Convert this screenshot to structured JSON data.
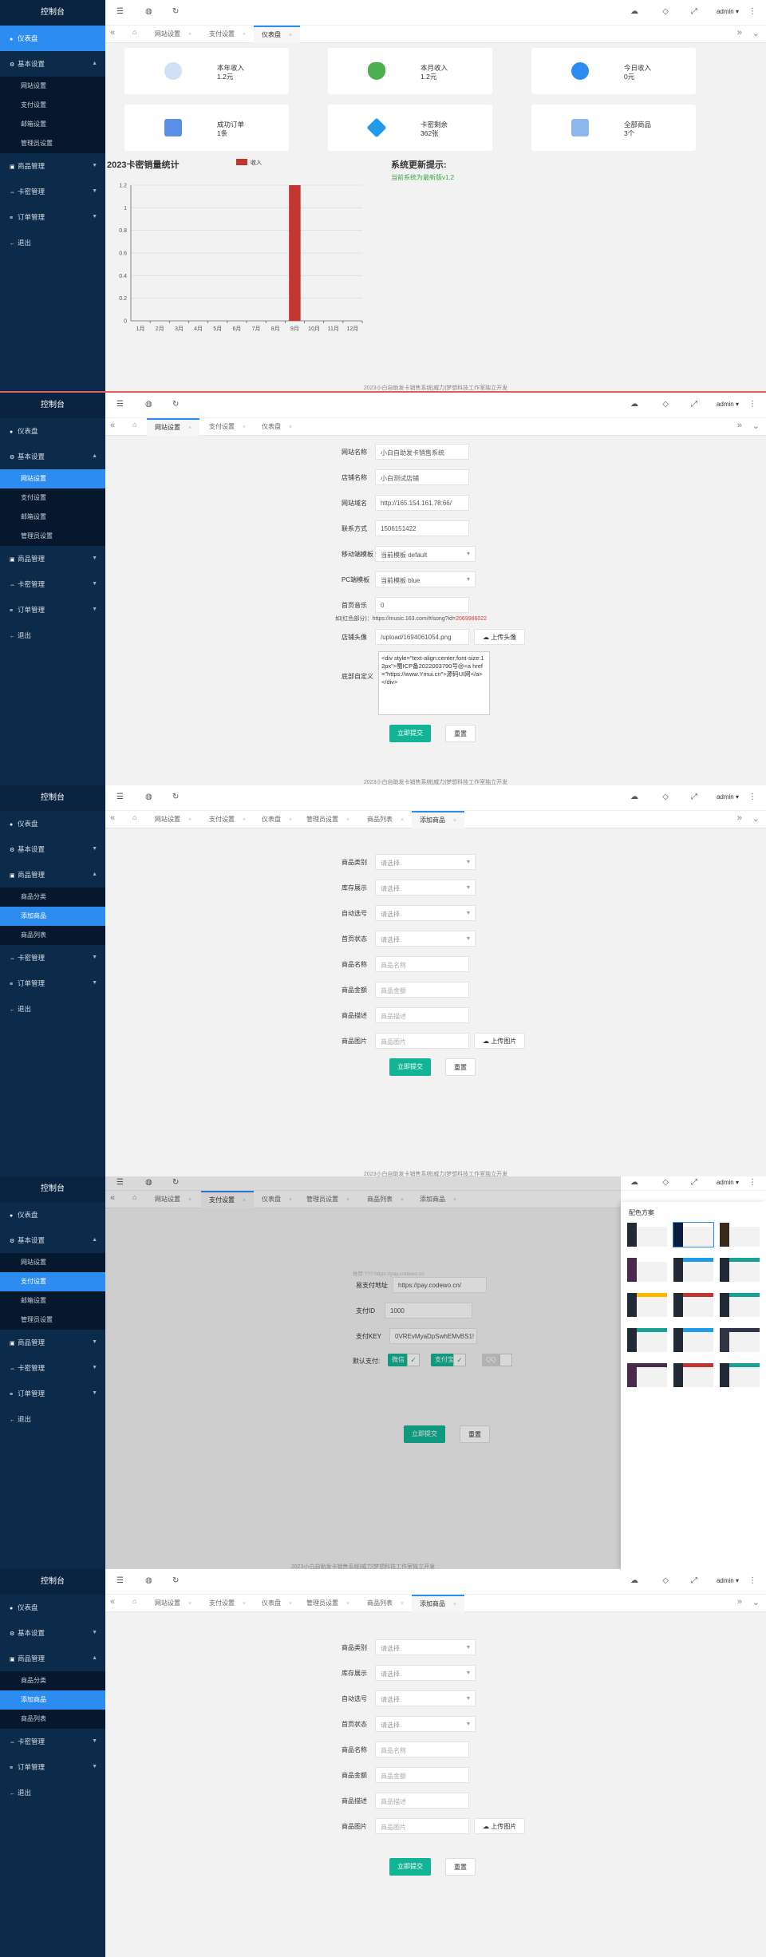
{
  "common": {
    "logo": "控制台",
    "admin": "admin ▾",
    "footer": "2023小白自助发卡销售系统|威力|梦想科技工作室独立开发"
  },
  "menu": {
    "dashboard": "仪表盘",
    "basic": "基本设置",
    "goods": "商品管理",
    "cards": "卡密管理",
    "orders": "订单管理",
    "logout": "退出",
    "basic_sub": [
      "网站设置",
      "支付设置",
      "邮箱设置",
      "管理员设置"
    ],
    "goods_sub": [
      "商品分类",
      "添加商品",
      "商品列表"
    ]
  },
  "tabs": {
    "site": "网站设置",
    "pay": "支付设置",
    "dash": "仪表盘",
    "admin": "管理员设置",
    "list": "商品列表",
    "add": "添加商品"
  },
  "dashboard": {
    "cards": [
      {
        "label": "本年收入",
        "value": "1.2元",
        "icon": "pie-icon",
        "color": "#8cb8ef"
      },
      {
        "label": "本月收入",
        "value": "1.2元",
        "icon": "money-bag-icon",
        "color": "#4caf50"
      },
      {
        "label": "今日收入",
        "value": "0元",
        "icon": "dollar-icon",
        "color": "#2d8cf0"
      },
      {
        "label": "成功订单",
        "value": "1条",
        "icon": "star-badge-icon",
        "color": "#5b8ee6"
      },
      {
        "label": "卡密剩余",
        "value": "362张",
        "icon": "cube-icon",
        "color": "#1e9be8"
      },
      {
        "label": "全部商品",
        "value": "3个",
        "icon": "chart-line-icon",
        "color": "#8cb8ef"
      }
    ],
    "notice_title": "系统更新提示:",
    "notice_text": "当前系统为最新版v1.2"
  },
  "chart_data": {
    "type": "bar",
    "title": "2023卡密销量统计",
    "legend": [
      "收入"
    ],
    "categories": [
      "1月",
      "2月",
      "3月",
      "4月",
      "5月",
      "6月",
      "7月",
      "8月",
      "9月",
      "10月",
      "11月",
      "12月"
    ],
    "series": [
      {
        "name": "收入",
        "values": [
          0,
          0,
          0,
          0,
          0,
          0,
          0,
          0,
          1.2,
          0,
          0,
          0
        ]
      }
    ],
    "yticks": [
      "0",
      "0.2",
      "0.4",
      "0.6",
      "0.8",
      "1",
      "1.2"
    ],
    "ylim": [
      0,
      1.2
    ],
    "color": "#c23531",
    "grid": true,
    "legend_position": "top"
  },
  "site": {
    "fields": [
      {
        "label": "网站名称",
        "value": "小白自助发卡销售系统"
      },
      {
        "label": "店铺名称",
        "value": "小白测试店铺"
      },
      {
        "label": "网站域名",
        "value": "http://165.154.161.78:66/"
      },
      {
        "label": "联系方式",
        "value": "1506151422"
      },
      {
        "label": "移动端模板",
        "value": "当前模板 default"
      },
      {
        "label": "PC端模板",
        "value": "当前模板 blue"
      },
      {
        "label": "首页音乐",
        "value": "0"
      }
    ],
    "music_hint": "如(红色部分)：https://music.163.com/#/song?id=",
    "music_hint_red": "2069986022",
    "avatar_label": "店铺头像",
    "avatar_value": "/upload/1694061054.png",
    "upload": "上传头像",
    "footer_label": "底部自定义",
    "footer_value": "<div style=\"text-align:center;font-size:12px\">蜀ICP备2022003790号@<a href=\"https://www.Ymui.cn\">源码UI网</a></div>",
    "submit": "立即提交",
    "reset": "重置"
  },
  "add": {
    "fields": [
      {
        "label": "商品类别",
        "ph": "请选择",
        "type": "sel"
      },
      {
        "label": "库存展示",
        "ph": "请选择",
        "type": "sel"
      },
      {
        "label": "自动选号",
        "ph": "请选择",
        "type": "sel"
      },
      {
        "label": "首页状态",
        "ph": "请选择",
        "type": "sel"
      },
      {
        "label": "商品名称",
        "ph": "商品名称",
        "type": "inp"
      },
      {
        "label": "商品金额",
        "ph": "商品金额",
        "type": "inp"
      },
      {
        "label": "商品描述",
        "ph": "商品描述",
        "type": "inp"
      },
      {
        "label": "商品图片",
        "ph": "商品图片",
        "type": "inp"
      }
    ],
    "upload": "上传图片",
    "submit": "立即提交",
    "reset": "重置"
  },
  "pay": {
    "hint": "推荐:???:https://pay.codewo.cn",
    "fields": [
      {
        "label": "易支付地址",
        "value": "https://pay.codewo.cn/"
      },
      {
        "label": "支付ID",
        "value": "1000"
      },
      {
        "label": "支付KEY",
        "value": "0VREvMyaDpSwhEMvBS1!"
      }
    ],
    "default_label": "默认支付:",
    "wx": "微信",
    "ali": "支付宝",
    "qq": "QQ",
    "submit": "立即提交",
    "reset": "重置",
    "theme_title": "配色方案"
  }
}
